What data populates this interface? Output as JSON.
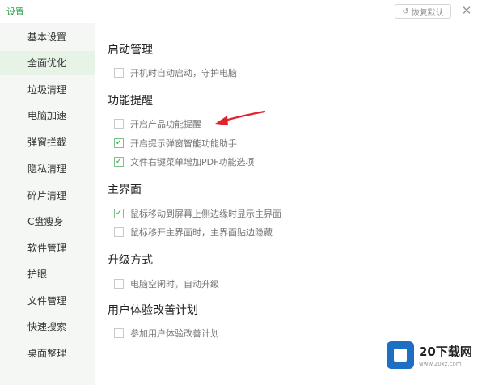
{
  "window": {
    "title": "设置",
    "restore_label": "恢复默认",
    "close_glyph": "✕",
    "restore_glyph": "↺"
  },
  "sidebar": {
    "items": [
      {
        "label": "基本设置",
        "active": false
      },
      {
        "label": "全面优化",
        "active": true
      },
      {
        "label": "垃圾清理",
        "active": false
      },
      {
        "label": "电脑加速",
        "active": false
      },
      {
        "label": "弹窗拦截",
        "active": false
      },
      {
        "label": "隐私清理",
        "active": false
      },
      {
        "label": "碎片清理",
        "active": false
      },
      {
        "label": "C盘瘦身",
        "active": false
      },
      {
        "label": "软件管理",
        "active": false
      },
      {
        "label": "护眼",
        "active": false
      },
      {
        "label": "文件管理",
        "active": false
      },
      {
        "label": "快速搜索",
        "active": false
      },
      {
        "label": "桌面整理",
        "active": false
      }
    ]
  },
  "sections": {
    "startup": {
      "title": "启动管理",
      "options": [
        {
          "label": "开机时自动启动，守护电脑",
          "checked": false
        }
      ]
    },
    "feature_tips": {
      "title": "功能提醒",
      "options": [
        {
          "label": "开启产品功能提醒",
          "checked": false
        },
        {
          "label": "开启提示弹窗智能功能助手",
          "checked": true
        },
        {
          "label": "文件右键菜单增加PDF功能选项",
          "checked": true
        }
      ]
    },
    "main_ui": {
      "title": "主界面",
      "options": [
        {
          "label": "鼠标移动到屏幕上侧边缘时显示主界面",
          "checked": true
        },
        {
          "label": "鼠标移开主界面时，主界面贴边隐藏",
          "checked": false
        }
      ]
    },
    "upgrade": {
      "title": "升级方式",
      "options": [
        {
          "label": "电脑空闲时，自动升级",
          "checked": false
        }
      ]
    },
    "ux_plan": {
      "title": "用户体验改善计划",
      "options": [
        {
          "label": "参加用户体验改善计划",
          "checked": false
        }
      ]
    }
  },
  "watermark": {
    "name": "20下载网",
    "url": "www.20xz.com"
  },
  "colors": {
    "accent": "#2fa24a",
    "sidebar_bg": "#f4f7f4",
    "active_bg": "#e6f3e6",
    "arrow": "#e0242a"
  },
  "check_glyph": "✓"
}
